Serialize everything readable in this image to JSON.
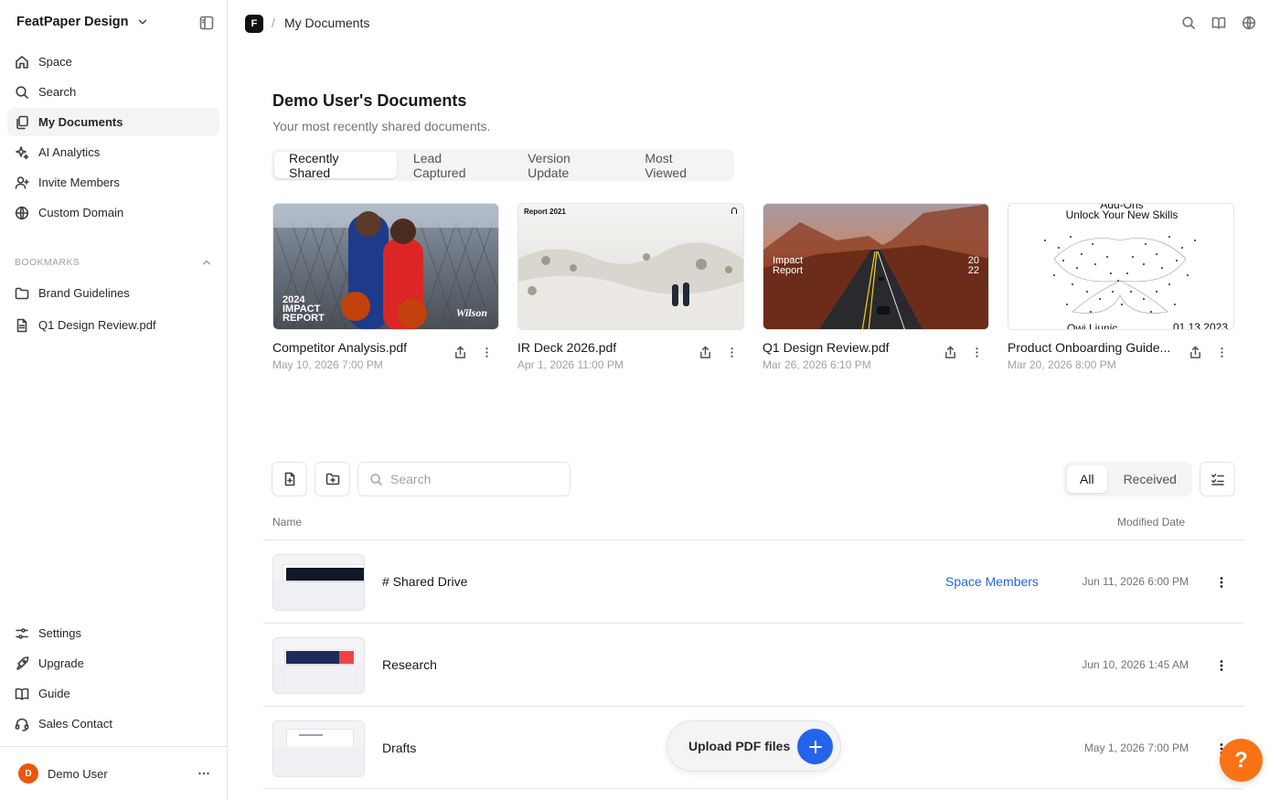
{
  "workspace": {
    "name": "FeatPaper Design"
  },
  "nav": {
    "items": [
      {
        "label": "Space",
        "icon": "home-icon"
      },
      {
        "label": "Search",
        "icon": "search-icon"
      },
      {
        "label": "My Documents",
        "icon": "documents-icon",
        "active": true
      },
      {
        "label": "AI Analytics",
        "icon": "sparkles-icon"
      },
      {
        "label": "Invite Members",
        "icon": "user-plus-icon"
      },
      {
        "label": "Custom Domain",
        "icon": "globe-icon"
      }
    ]
  },
  "bookmarks": {
    "heading": "BOOKMARKS",
    "items": [
      {
        "label": "Brand Guidelines",
        "icon": "folder-icon"
      },
      {
        "label": "Q1 Design Review.pdf",
        "icon": "file-icon"
      }
    ]
  },
  "bottom_nav": {
    "items": [
      {
        "label": "Settings",
        "icon": "settings-icon"
      },
      {
        "label": "Upgrade",
        "icon": "rocket-icon"
      },
      {
        "label": "Guide",
        "icon": "book-icon"
      },
      {
        "label": "Sales Contact",
        "icon": "headset-icon"
      }
    ]
  },
  "user": {
    "initial": "D",
    "name": "Demo User",
    "avatar_color": "#ea580c"
  },
  "topbar": {
    "logo_letter": "F",
    "separator": "/",
    "breadcrumb": "My Documents"
  },
  "main": {
    "title": "Demo User's Documents",
    "subtitle": "Your most recently shared documents.",
    "tabs": [
      {
        "label": "Recently Shared",
        "active": true
      },
      {
        "label": "Lead Captured"
      },
      {
        "label": "Version Update"
      },
      {
        "label": "Most Viewed"
      }
    ],
    "cards": [
      {
        "title": "Competitor Analysis.pdf",
        "date": "May 10, 2026 7:00 PM",
        "thumb": {
          "line1": "2024",
          "line2": "IMPACT",
          "line3": "REPORT",
          "brand": "Wilson"
        }
      },
      {
        "title": "IR Deck 2026.pdf",
        "date": "Apr 1, 2026 11:00 PM",
        "thumb": {
          "line1": "Report 2021"
        }
      },
      {
        "title": "Q1 Design Review.pdf",
        "date": "Mar 26, 2026 6:10 PM",
        "thumb": {
          "line1": "Impact",
          "line2": "Report",
          "year_top": "20",
          "year_bottom": "22"
        }
      },
      {
        "title": "Product Onboarding Guide...",
        "date": "Mar 20, 2026 8:00 PM",
        "thumb": {
          "line1": "Add-Ons",
          "line2": "Unlock Your New Skills",
          "author": "Owi Liunic",
          "date": "01.13.2023"
        }
      }
    ]
  },
  "toolbar": {
    "search_placeholder": "Search",
    "filter": [
      {
        "label": "All",
        "active": true
      },
      {
        "label": "Received"
      }
    ]
  },
  "table": {
    "col_name": "Name",
    "col_date": "Modified Date",
    "rows": [
      {
        "name": "# Shared Drive",
        "link": "Space Members",
        "date": "Jun 11, 2026 6:00 PM"
      },
      {
        "name": "Research",
        "link": "",
        "date": "Jun 10, 2026 1:45 AM"
      },
      {
        "name": "Drafts",
        "link": "",
        "date": "May 1, 2026 7:00 PM"
      }
    ]
  },
  "upload": {
    "label": "Upload PDF files"
  },
  "help": {
    "label": "?"
  },
  "colors": {
    "accent": "#2563eb",
    "help": "#f97316",
    "avatar": "#ea580c"
  }
}
